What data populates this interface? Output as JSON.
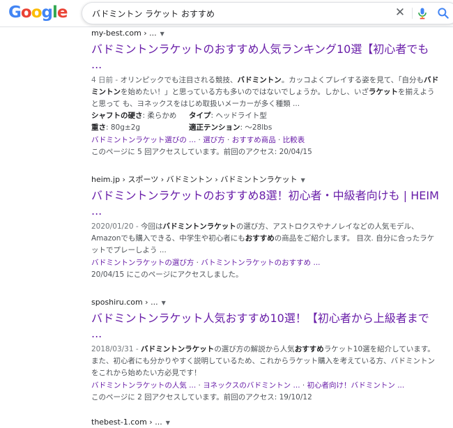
{
  "header": {
    "logo_letters": [
      "G",
      "o",
      "o",
      "g",
      "l",
      "e"
    ],
    "search_value": "バドミントン ラケット おすすめ",
    "icons": {
      "clear": "close-icon",
      "mic": "microphone-icon",
      "search": "magnifier-icon"
    },
    "colors": {
      "blue": "#4285f4",
      "red": "#ea4335",
      "yellow": "#fbbc05",
      "green": "#34a853",
      "link_visited": "#681da8"
    }
  },
  "results": [
    {
      "cite": "my-best.com › ...",
      "title": "バドミントンラケットのおすすめ人気ランキング10選【初心者でも ...",
      "snippet_date": "4 日前 - ",
      "snippet": [
        {
          "t": "オリンピックでも注目される競技、",
          "b": false
        },
        {
          "t": "バドミントン",
          "b": true
        },
        {
          "t": "。カッコよくプレイする姿を見て、「自分も",
          "b": false
        },
        {
          "t": "バドミントン",
          "b": true
        },
        {
          "t": "を始めたい！」と思っている方も多いのではないでしょうか。しかし、いざ",
          "b": false
        },
        {
          "t": "ラケット",
          "b": true
        },
        {
          "t": "を揃えようと思って も、ヨネックスをはじめ取扱いメーカーが多く種類 ...",
          "b": false
        }
      ],
      "attributes": [
        [
          {
            "label": "シャフトの硬さ",
            "value": ": 柔らかめ"
          },
          {
            "label": "タイプ",
            "value": ": ヘッドライト型"
          }
        ],
        [
          {
            "label": "重さ",
            "value": ": 80g±2g"
          },
          {
            "label": "適正テンション",
            "value": ": 〜28lbs"
          }
        ]
      ],
      "sitelinks": [
        "バドミントンラケット選びの ...",
        "選び方",
        "おすすめ商品",
        "比較表"
      ],
      "visited": "このページに 5 回アクセスしています。前回のアクセス: 20/04/15"
    },
    {
      "cite": "heim.jp › スポーツ › バドミントン › バドミントンラケット",
      "title": "バドミントンラケットのおすすめ8選！初心者・中級者向けも | HEIM ...",
      "snippet_date": "2020/01/20 - ",
      "snippet": [
        {
          "t": "今回は",
          "b": false
        },
        {
          "t": "バドミントンラケット",
          "b": true
        },
        {
          "t": "の選び方、アストロクスやナノレイなどの人気モデル、Amazonでも購入できる、中学生や初心者にも",
          "b": false
        },
        {
          "t": "おすすめ",
          "b": true
        },
        {
          "t": "の商品をご紹介します。 目次. 自分に合ったラケットでプレーしよう ...",
          "b": false
        }
      ],
      "sitelinks": [
        "バドミントンラケットの選び方",
        "バトミントンラケットのおすすめ ..."
      ],
      "visited": "20/04/15 にこのページにアクセスしました。"
    },
    {
      "cite": "sposhiru.com › ...",
      "title": "バドミントンラケット人気おすすめ10選！【初心者から上級者まで ...",
      "snippet_date": "2018/03/31 - ",
      "snippet": [
        {
          "t": "バドミントンラケット",
          "b": true
        },
        {
          "t": "の選び方の解説から人気",
          "b": false
        },
        {
          "t": "おすすめ",
          "b": true
        },
        {
          "t": "ラケット10選を紹介しています。また、初心者にも分かりやすく説明しているため、これからラケット購入を考えている方、バドミントンをこれから始めたい方必見です！",
          "b": false
        }
      ],
      "sitelinks": [
        "バドミントンラケットの人気 ...",
        "ヨネックスのバドミントン ...",
        "初心者向け！バドミントン ..."
      ],
      "visited": "このページに 2 回アクセスしています。前回のアクセス: 19/10/12"
    },
    {
      "cite": "thebest-1.com › ..."
    }
  ]
}
